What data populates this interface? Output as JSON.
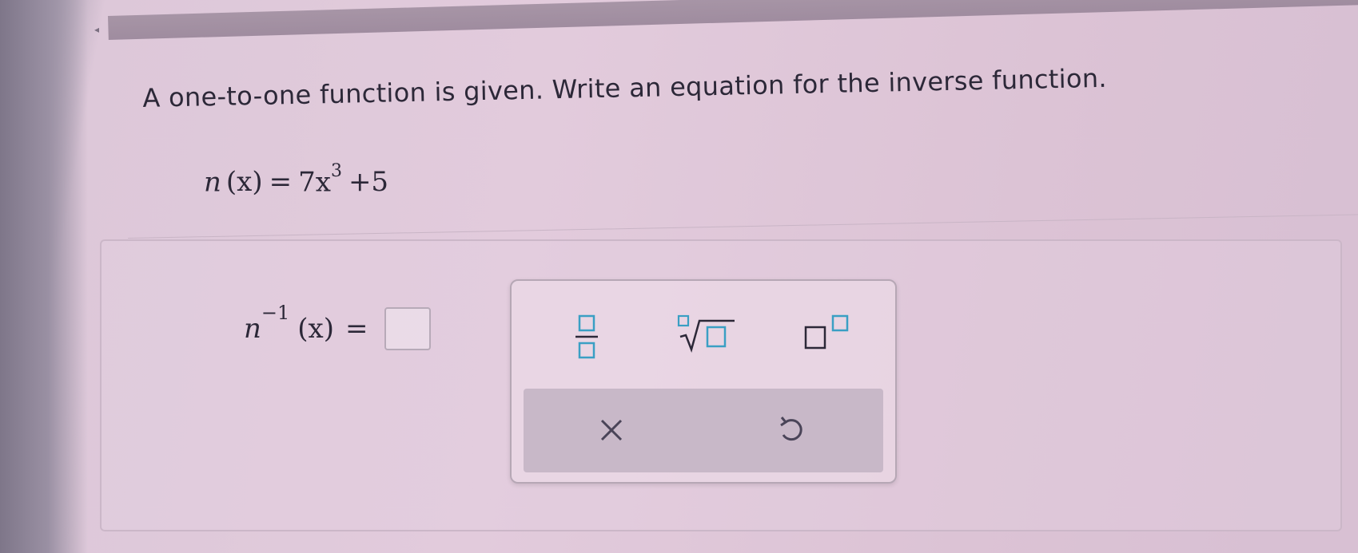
{
  "question": {
    "text": "A one-to-one function is given. Write an equation for the inverse function."
  },
  "given_function": {
    "name": "n",
    "argument": "(x)",
    "equals": "=",
    "coefficient": "7x",
    "exponent": "3",
    "constant": "+5"
  },
  "answer": {
    "name": "n",
    "exponent": "−1",
    "argument": "(x)",
    "equals": "=",
    "value": ""
  },
  "palette": {
    "tools": [
      {
        "name": "fraction",
        "icon": "fraction-icon"
      },
      {
        "name": "nth-root",
        "icon": "nth-root-icon"
      },
      {
        "name": "superscript",
        "icon": "superscript-icon"
      }
    ],
    "actions": [
      {
        "name": "clear",
        "icon": "close-icon",
        "glyph": "×"
      },
      {
        "name": "undo",
        "icon": "undo-icon"
      }
    ],
    "accent_color": "#3a9fc4"
  }
}
